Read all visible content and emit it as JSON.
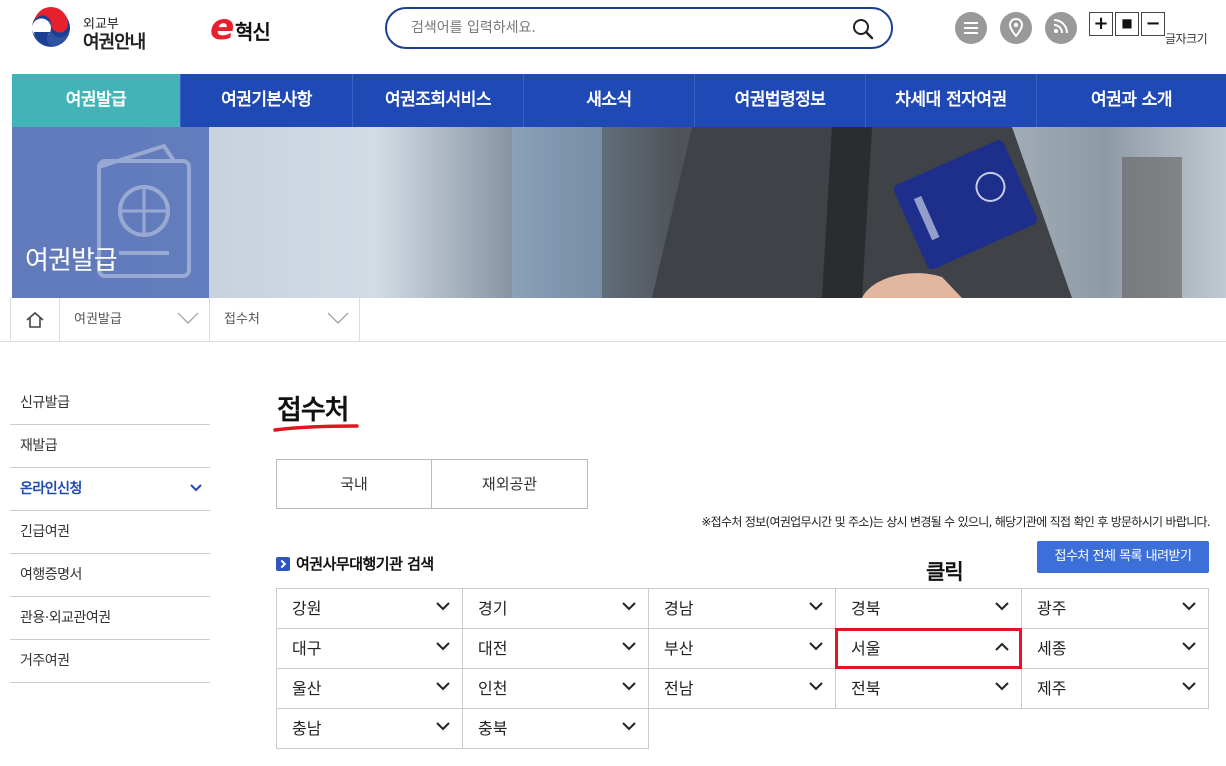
{
  "header": {
    "logo_sub": "외교부",
    "logo_main": "여권안내",
    "einno_e": "e",
    "einno_text": "혁신",
    "search_placeholder": "검색어를 입력하세요.",
    "font_size_label": "글자크기",
    "font_plus": "+",
    "font_reset": "■",
    "font_minus": "−"
  },
  "gnb": {
    "items": [
      "여권발급",
      "여권기본사항",
      "여권조회서비스",
      "새소식",
      "여권법령정보",
      "차세대 전자여권",
      "여권과 소개"
    ],
    "active_index": 0
  },
  "visual": {
    "title": "여권발급"
  },
  "breadcrumb": {
    "level1": "여권발급",
    "level2": "접수처"
  },
  "lnb": {
    "items": [
      "신규발급",
      "재발급",
      "온라인신청",
      "긴급여권",
      "여행증명서",
      "관용·외교관여권",
      "거주여권"
    ],
    "active_index": 2
  },
  "content": {
    "title": "접수처",
    "tabs": [
      "국내",
      "재외공관"
    ],
    "notice": "※접수처 정보(여권업무시간 및 주소)는 상시 변경될 수 있으니, 해당기관에 직접 확인 후 방문하시기 바랍니다.",
    "section_title": "여권사무대행기관 검색",
    "download_button": "접수처 전체 목록 내려받기",
    "click_annotation": "클릭",
    "regions": [
      "강원",
      "경기",
      "경남",
      "경북",
      "광주",
      "대구",
      "대전",
      "부산",
      "서울",
      "세종",
      "울산",
      "인천",
      "전남",
      "전북",
      "제주",
      "충남",
      "충북"
    ],
    "selected_region": "서울"
  },
  "colors": {
    "gnb_bg": "#1f4ab5",
    "gnb_active": "#42b4b7",
    "highlight": "#e3141f",
    "download_btn": "#3d6fd8"
  }
}
